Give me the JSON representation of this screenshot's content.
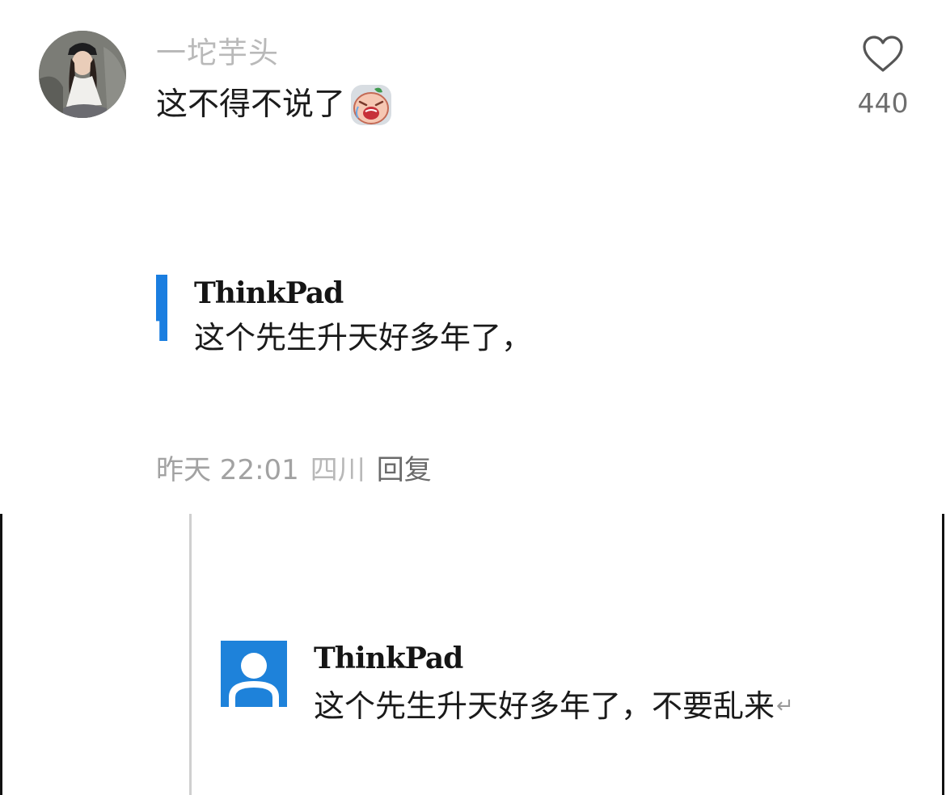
{
  "comment": {
    "username": "一坨芋头",
    "text": "这不得不说了",
    "emoji": "crying-face-emoji",
    "like_icon": "heart-outline-icon",
    "like_count": "440"
  },
  "quote1": {
    "name": "ThinkPad",
    "text": "这个先生升天好多年了，"
  },
  "meta": {
    "time": "昨天 22:01",
    "location": "四川",
    "reply_label": "回复"
  },
  "quote2": {
    "name": "ThinkPad",
    "text": "这个先生升天好多年了，不要乱来",
    "return_mark": "↵",
    "avatar_icon": "default-user-icon"
  },
  "colors": {
    "accent_blue": "#1a7ee0",
    "avatar_blue": "#1e82da",
    "muted_text": "#a2a2a2"
  }
}
